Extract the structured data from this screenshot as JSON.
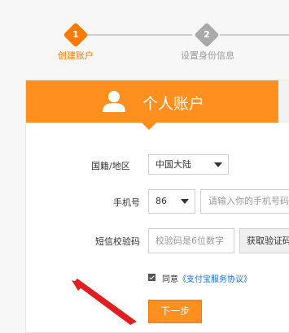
{
  "steps": [
    {
      "number": "1",
      "label": "创建账户",
      "active": true,
      "color": "#ff7a00"
    },
    {
      "number": "2",
      "label": "设置身份信息",
      "active": false,
      "color": "#a9a9a9"
    }
  ],
  "header": {
    "title": "个人账户",
    "icon": "user-icon",
    "color": "#ff8f1f"
  },
  "form": {
    "country": {
      "label": "国籍/地区",
      "value": "中国大陆"
    },
    "phone": {
      "label": "手机号",
      "code": "86",
      "placeholder": "请输入你的手机号码"
    },
    "sms": {
      "label": "短信校验码",
      "placeholder": "校验码是6位数字",
      "button": "获取验证码"
    },
    "agreement": {
      "checked": true,
      "prefix": "同意",
      "link": "《支付宝服务协议》"
    },
    "next_button": "下一步"
  }
}
